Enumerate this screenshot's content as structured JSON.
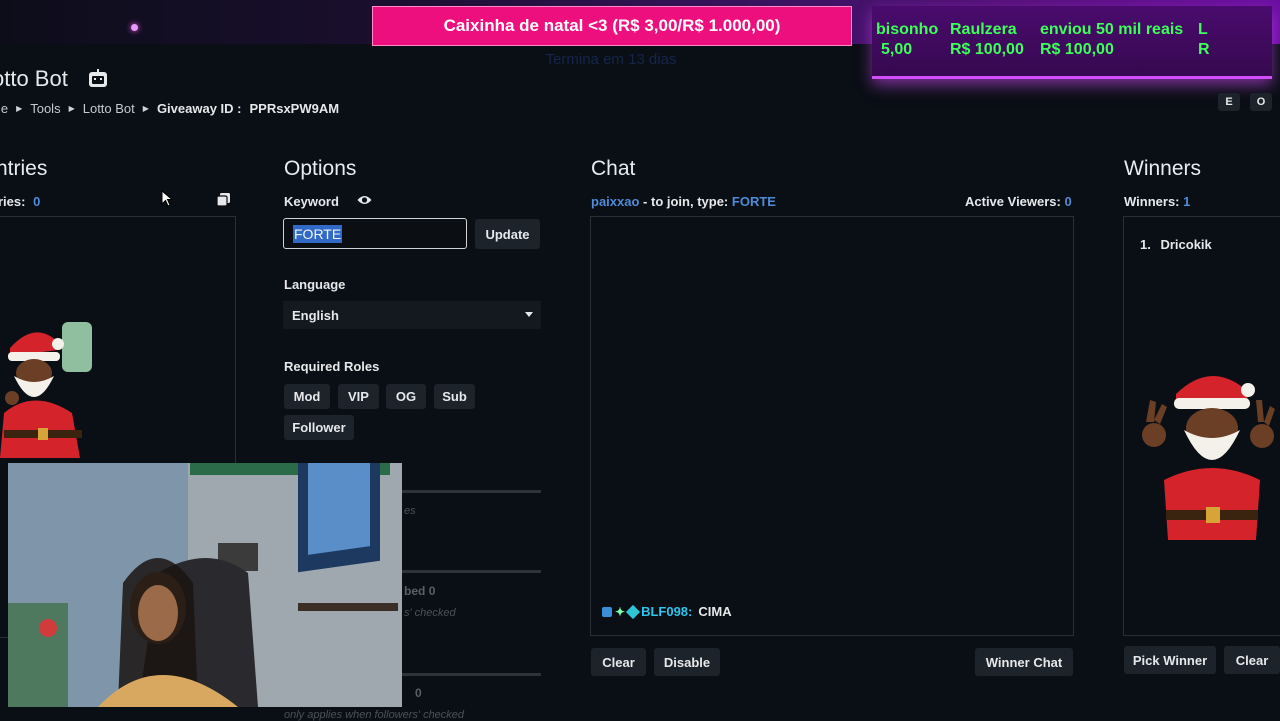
{
  "overlay": {
    "goal_text": "Caixinha de natal <3 (R$ 3,00/R$ 1.000,00)",
    "goal_subtext": "Termina em 13 dias",
    "donors": [
      {
        "name": "bisonho",
        "amount": "5,00"
      },
      {
        "name": "Raulzera",
        "amount": "R$ 100,00"
      },
      {
        "name": "enviou 50 mil reais",
        "amount": "R$ 100,00"
      },
      {
        "name": "L",
        "amount": "R"
      }
    ],
    "colors": {
      "goal_bg": "#ee0f7e",
      "donor_text": "#3cff58",
      "donor_bg": "#4a0b6e"
    }
  },
  "header": {
    "title": "otto Bot",
    "breadcrumb": [
      "me",
      "Tools",
      "Lotto Bot"
    ],
    "giveaway_label": "Giveaway ID :",
    "giveaway_id": "PPRsxPW9AM",
    "right_buttons": [
      "E",
      "O"
    ]
  },
  "entries": {
    "title": "ntries",
    "count_label": "ries:",
    "count": "0"
  },
  "options": {
    "title": "Options",
    "keyword_label": "Keyword",
    "keyword_value": "FORTE",
    "update_label": "Update",
    "language_label": "Language",
    "language_value": "English",
    "roles_label": "Required Roles",
    "roles": [
      "Mod",
      "VIP",
      "OG",
      "Sub",
      "Follower"
    ],
    "partial_values": [
      "0",
      "0"
    ],
    "partial_texts": [
      "bed",
      "s' checked",
      "es"
    ],
    "footer_note": "only applies when followers' checked"
  },
  "chat": {
    "title": "Chat",
    "channel": "paixxao",
    "join_text": "- to join, type:",
    "keyword": "FORTE",
    "viewers_label": "Active Viewers:",
    "viewers": "0",
    "messages": [
      {
        "user": "BLF098:",
        "text": "CIMA"
      }
    ],
    "clear_label": "Clear",
    "disable_label": "Disable",
    "winner_chat_label": "Winner Chat"
  },
  "winners": {
    "title": "Winners",
    "count_label": "Winners:",
    "count": "1",
    "list": [
      "Dricokik"
    ],
    "pick_label": "Pick Winner",
    "clear_label": "Clear"
  }
}
